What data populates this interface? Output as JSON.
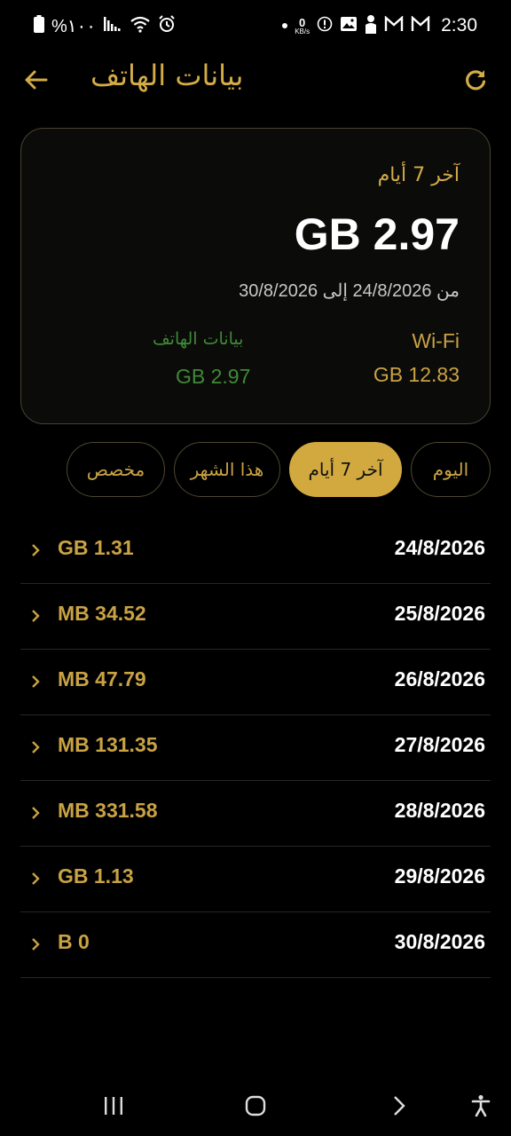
{
  "status_bar": {
    "battery_percent": "%١٠٠",
    "net_speed_value": "0",
    "net_speed_unit": "KB/s",
    "time": "2:30"
  },
  "header": {
    "title": "بيانات الهاتف"
  },
  "summary": {
    "period_label": "آخر 7 أيام",
    "total": "GB 2.97",
    "date_range": "من 24/8/2026 إلى 30/8/2026",
    "wifi_label": "Wi-Fi",
    "wifi_value": "GB 12.83",
    "mobile_label": "بيانات الهاتف",
    "mobile_value": "GB 2.97"
  },
  "filters": [
    {
      "label": "اليوم"
    },
    {
      "label": "آخر 7 أيام",
      "active": true
    },
    {
      "label": "هذا الشهر"
    },
    {
      "label": "مخصص"
    }
  ],
  "daily_usage": [
    {
      "date": "24/8/2026",
      "usage": "GB 1.31"
    },
    {
      "date": "25/8/2026",
      "usage": "MB 34.52"
    },
    {
      "date": "26/8/2026",
      "usage": "MB 47.79"
    },
    {
      "date": "27/8/2026",
      "usage": "MB 131.35"
    },
    {
      "date": "28/8/2026",
      "usage": "MB 331.58"
    },
    {
      "date": "29/8/2026",
      "usage": "GB 1.13"
    },
    {
      "date": "30/8/2026",
      "usage": "B 0"
    }
  ],
  "colors": {
    "accent": "#d4ac47",
    "mobile_green": "#3f8a36",
    "background": "#000000"
  },
  "icons": [
    "back-arrow-icon",
    "refresh-icon",
    "chevron-right-icon",
    "recents-icon",
    "home-icon",
    "back-nav-icon",
    "accessibility-icon"
  ]
}
